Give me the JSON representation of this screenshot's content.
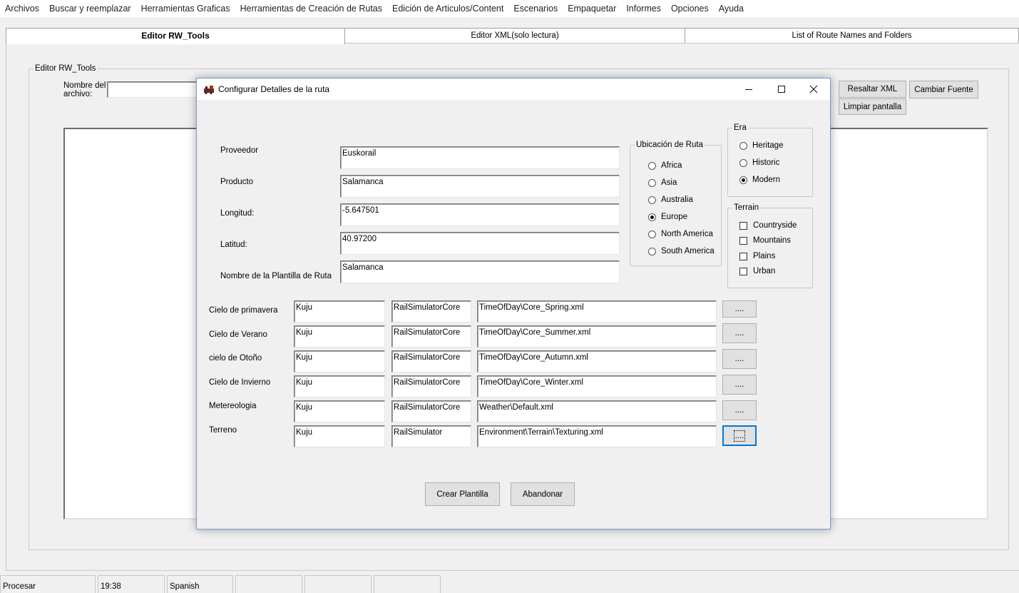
{
  "menu": [
    "Archivos",
    "Buscar y reemplazar",
    "Herramientas Graficas",
    "Herramientas de Creación de Rutas",
    "Edición de Articulos/Content",
    "Escenarios",
    "Empaquetar",
    "Informes",
    "Opciones",
    "Ayuda"
  ],
  "tabs": [
    "Editor RW_Tools",
    "Editor XML(solo lectura)",
    "List of Route Names and Folders"
  ],
  "editor": {
    "group_title": "Editor RW_Tools",
    "filename_label_1": "Nombre del",
    "filename_label_2": "archivo:",
    "filename_value": "",
    "highlight_button": "Resaltar XML",
    "clear_button": "Limpiar pantalla",
    "font_button": "Cambiar Fuente"
  },
  "dialog": {
    "title": "Configurar Detalles de la ruta",
    "fields": [
      {
        "label": "Proveedor",
        "value": "Euskorail"
      },
      {
        "label": "Producto",
        "value": "Salamanca"
      },
      {
        "label": "Longitud:",
        "value": "-5.647501"
      },
      {
        "label": "Latitud:",
        "value": "40.97200"
      },
      {
        "label": "Nombre de la Plantilla de Ruta",
        "value": "Salamanca"
      }
    ],
    "location": {
      "title": "Ubicación de Ruta",
      "options": [
        "Africa",
        "Asia",
        "Australia",
        "Europe",
        "North America",
        "South America"
      ],
      "selected": "Europe"
    },
    "era": {
      "title": "Era",
      "options": [
        "Heritage",
        "Historic",
        "Modern"
      ],
      "selected": "Modern"
    },
    "terrain": {
      "title": "Terrain",
      "options": [
        "Countryside",
        "Mountains",
        "Plains",
        "Urban"
      ]
    },
    "assets": [
      {
        "label": "Cielo de primavera",
        "provider": "Kuju",
        "product": "RailSimulatorCore",
        "path": "TimeOfDay\\Core_Spring.xml"
      },
      {
        "label": "Cielo de Verano",
        "provider": "Kuju",
        "product": "RailSimulatorCore",
        "path": "TimeOfDay\\Core_Summer.xml"
      },
      {
        "label": "cielo de Otoño",
        "provider": "Kuju",
        "product": "RailSimulatorCore",
        "path": "TimeOfDay\\Core_Autumn.xml"
      },
      {
        "label": "Cielo de Invierno",
        "provider": "Kuju",
        "product": "RailSimulatorCore",
        "path": "TimeOfDay\\Core_Winter.xml"
      },
      {
        "label": "Metereologia",
        "provider": "Kuju",
        "product": "RailSimulatorCore",
        "path": "Weather\\Default.xml"
      },
      {
        "label": "Terreno",
        "provider": "Kuju",
        "product": "RailSimulator",
        "path": "Environment\\Terrain\\Texturing.xml"
      }
    ],
    "browse_label": "....",
    "create_button": "Crear Plantilla",
    "cancel_button": "Abandonar"
  },
  "status": [
    "Procesar",
    "19:38",
    "Spanish",
    "",
    "",
    ""
  ]
}
